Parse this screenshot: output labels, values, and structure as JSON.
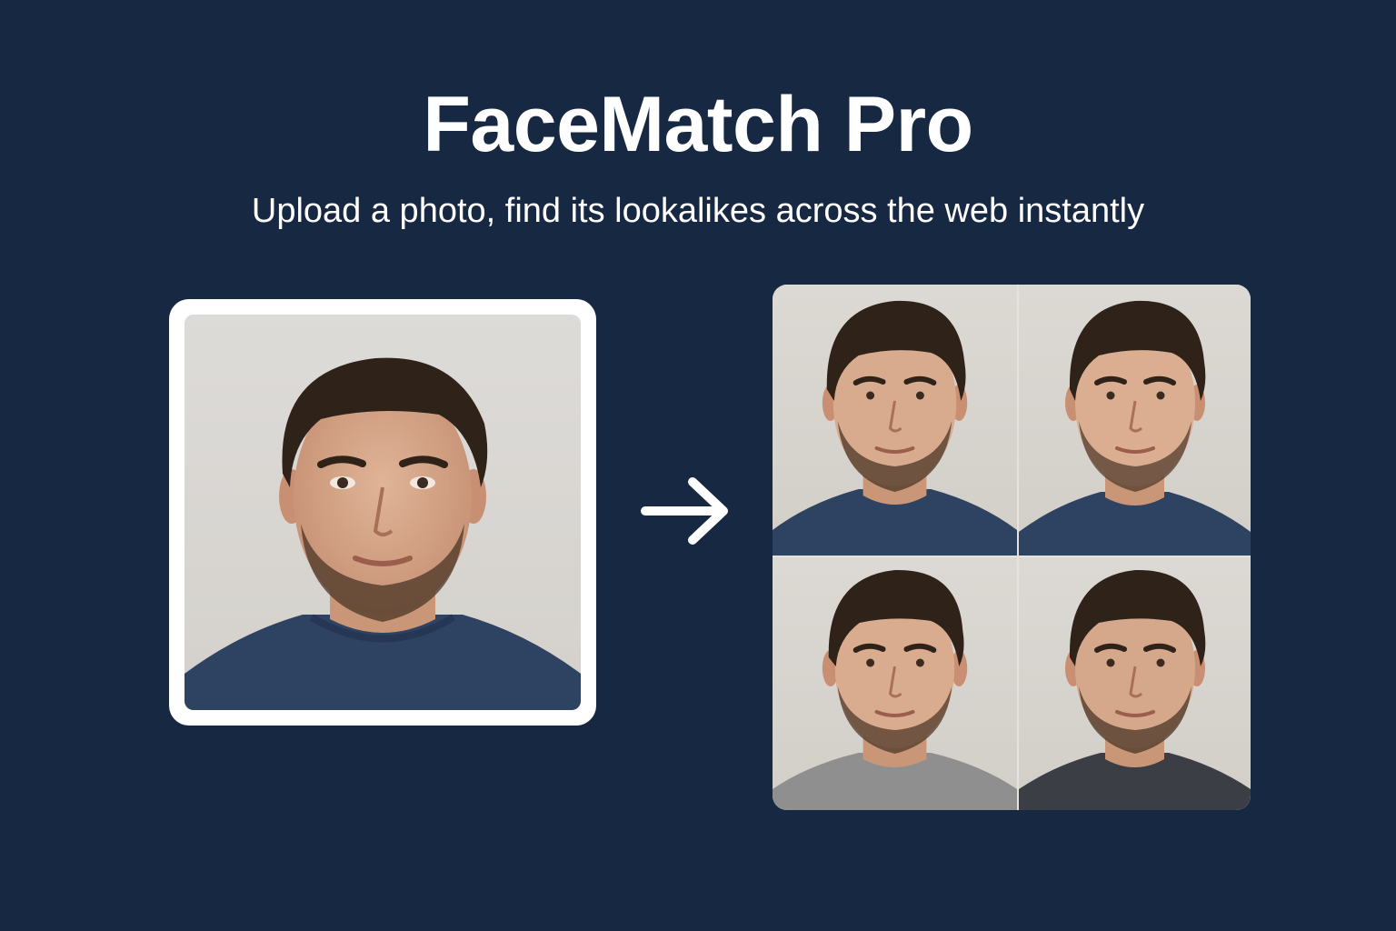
{
  "header": {
    "title": "FaceMatch Pro",
    "subtitle": "Upload a photo, find its lookalikes across the web instantly"
  },
  "upload": {
    "image_alt": "uploaded portrait photo"
  },
  "arrow_icon": "arrow-right-icon",
  "results": {
    "items": [
      {
        "name": "result-1",
        "shirt_color": "#2e4261"
      },
      {
        "name": "result-2",
        "shirt_color": "#2e4261"
      },
      {
        "name": "result-3",
        "shirt_color": "#8e8f8e"
      },
      {
        "name": "result-4",
        "shirt_color": "#3b3e45"
      }
    ]
  },
  "colors": {
    "background": "#172843",
    "text": "#ffffff",
    "card_frame": "#ffffff",
    "photo_bg": "#d8d5d0",
    "hair": "#2f2219",
    "skin": "#d6a78a",
    "shirt_navy": "#2e4261"
  }
}
